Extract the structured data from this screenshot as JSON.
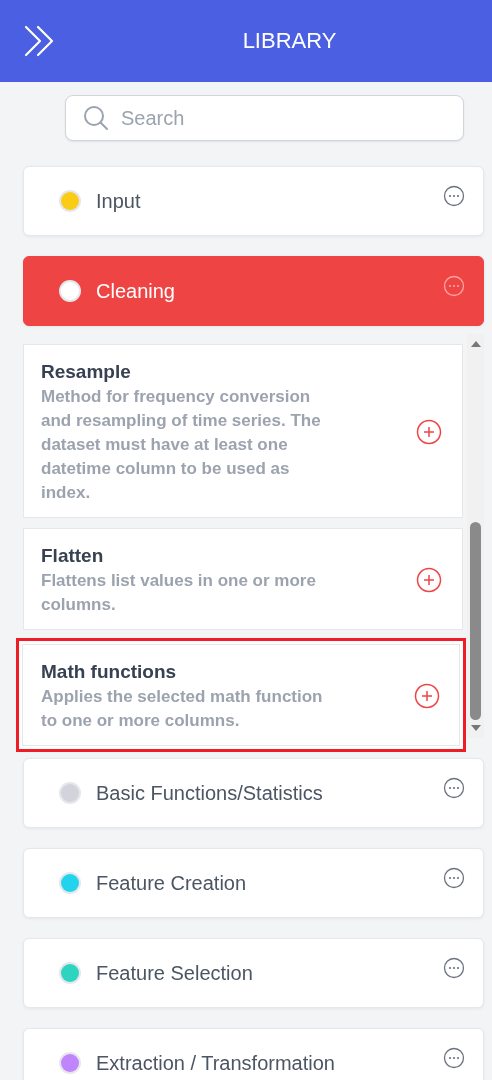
{
  "header": {
    "title": "LIBRARY"
  },
  "search": {
    "placeholder": "Search"
  },
  "categories": [
    {
      "label": "Input",
      "color": "#facc15",
      "selected": false
    },
    {
      "label": "Cleaning",
      "color": "#ffffff",
      "selected": true,
      "functions": [
        {
          "title": "Resample",
          "description": "Method for frequency conversion and resampling of time series. The dataset must have at least one datetime column to be used as index.",
          "highlighted": false
        },
        {
          "title": "Flatten",
          "description": "Flattens list values in one or more columns.",
          "highlighted": false
        },
        {
          "title": "Math functions",
          "description": "Applies the selected math function to one or more columns.",
          "highlighted": true
        }
      ]
    },
    {
      "label": "Basic Functions/Statistics",
      "color": "#d1d5db",
      "selected": false
    },
    {
      "label": "Feature Creation",
      "color": "#22d3ee",
      "selected": false
    },
    {
      "label": "Feature Selection",
      "color": "#2dd4bf",
      "selected": false
    },
    {
      "label": "Extraction / Transformation",
      "color": "#c084fc",
      "selected": false
    }
  ]
}
